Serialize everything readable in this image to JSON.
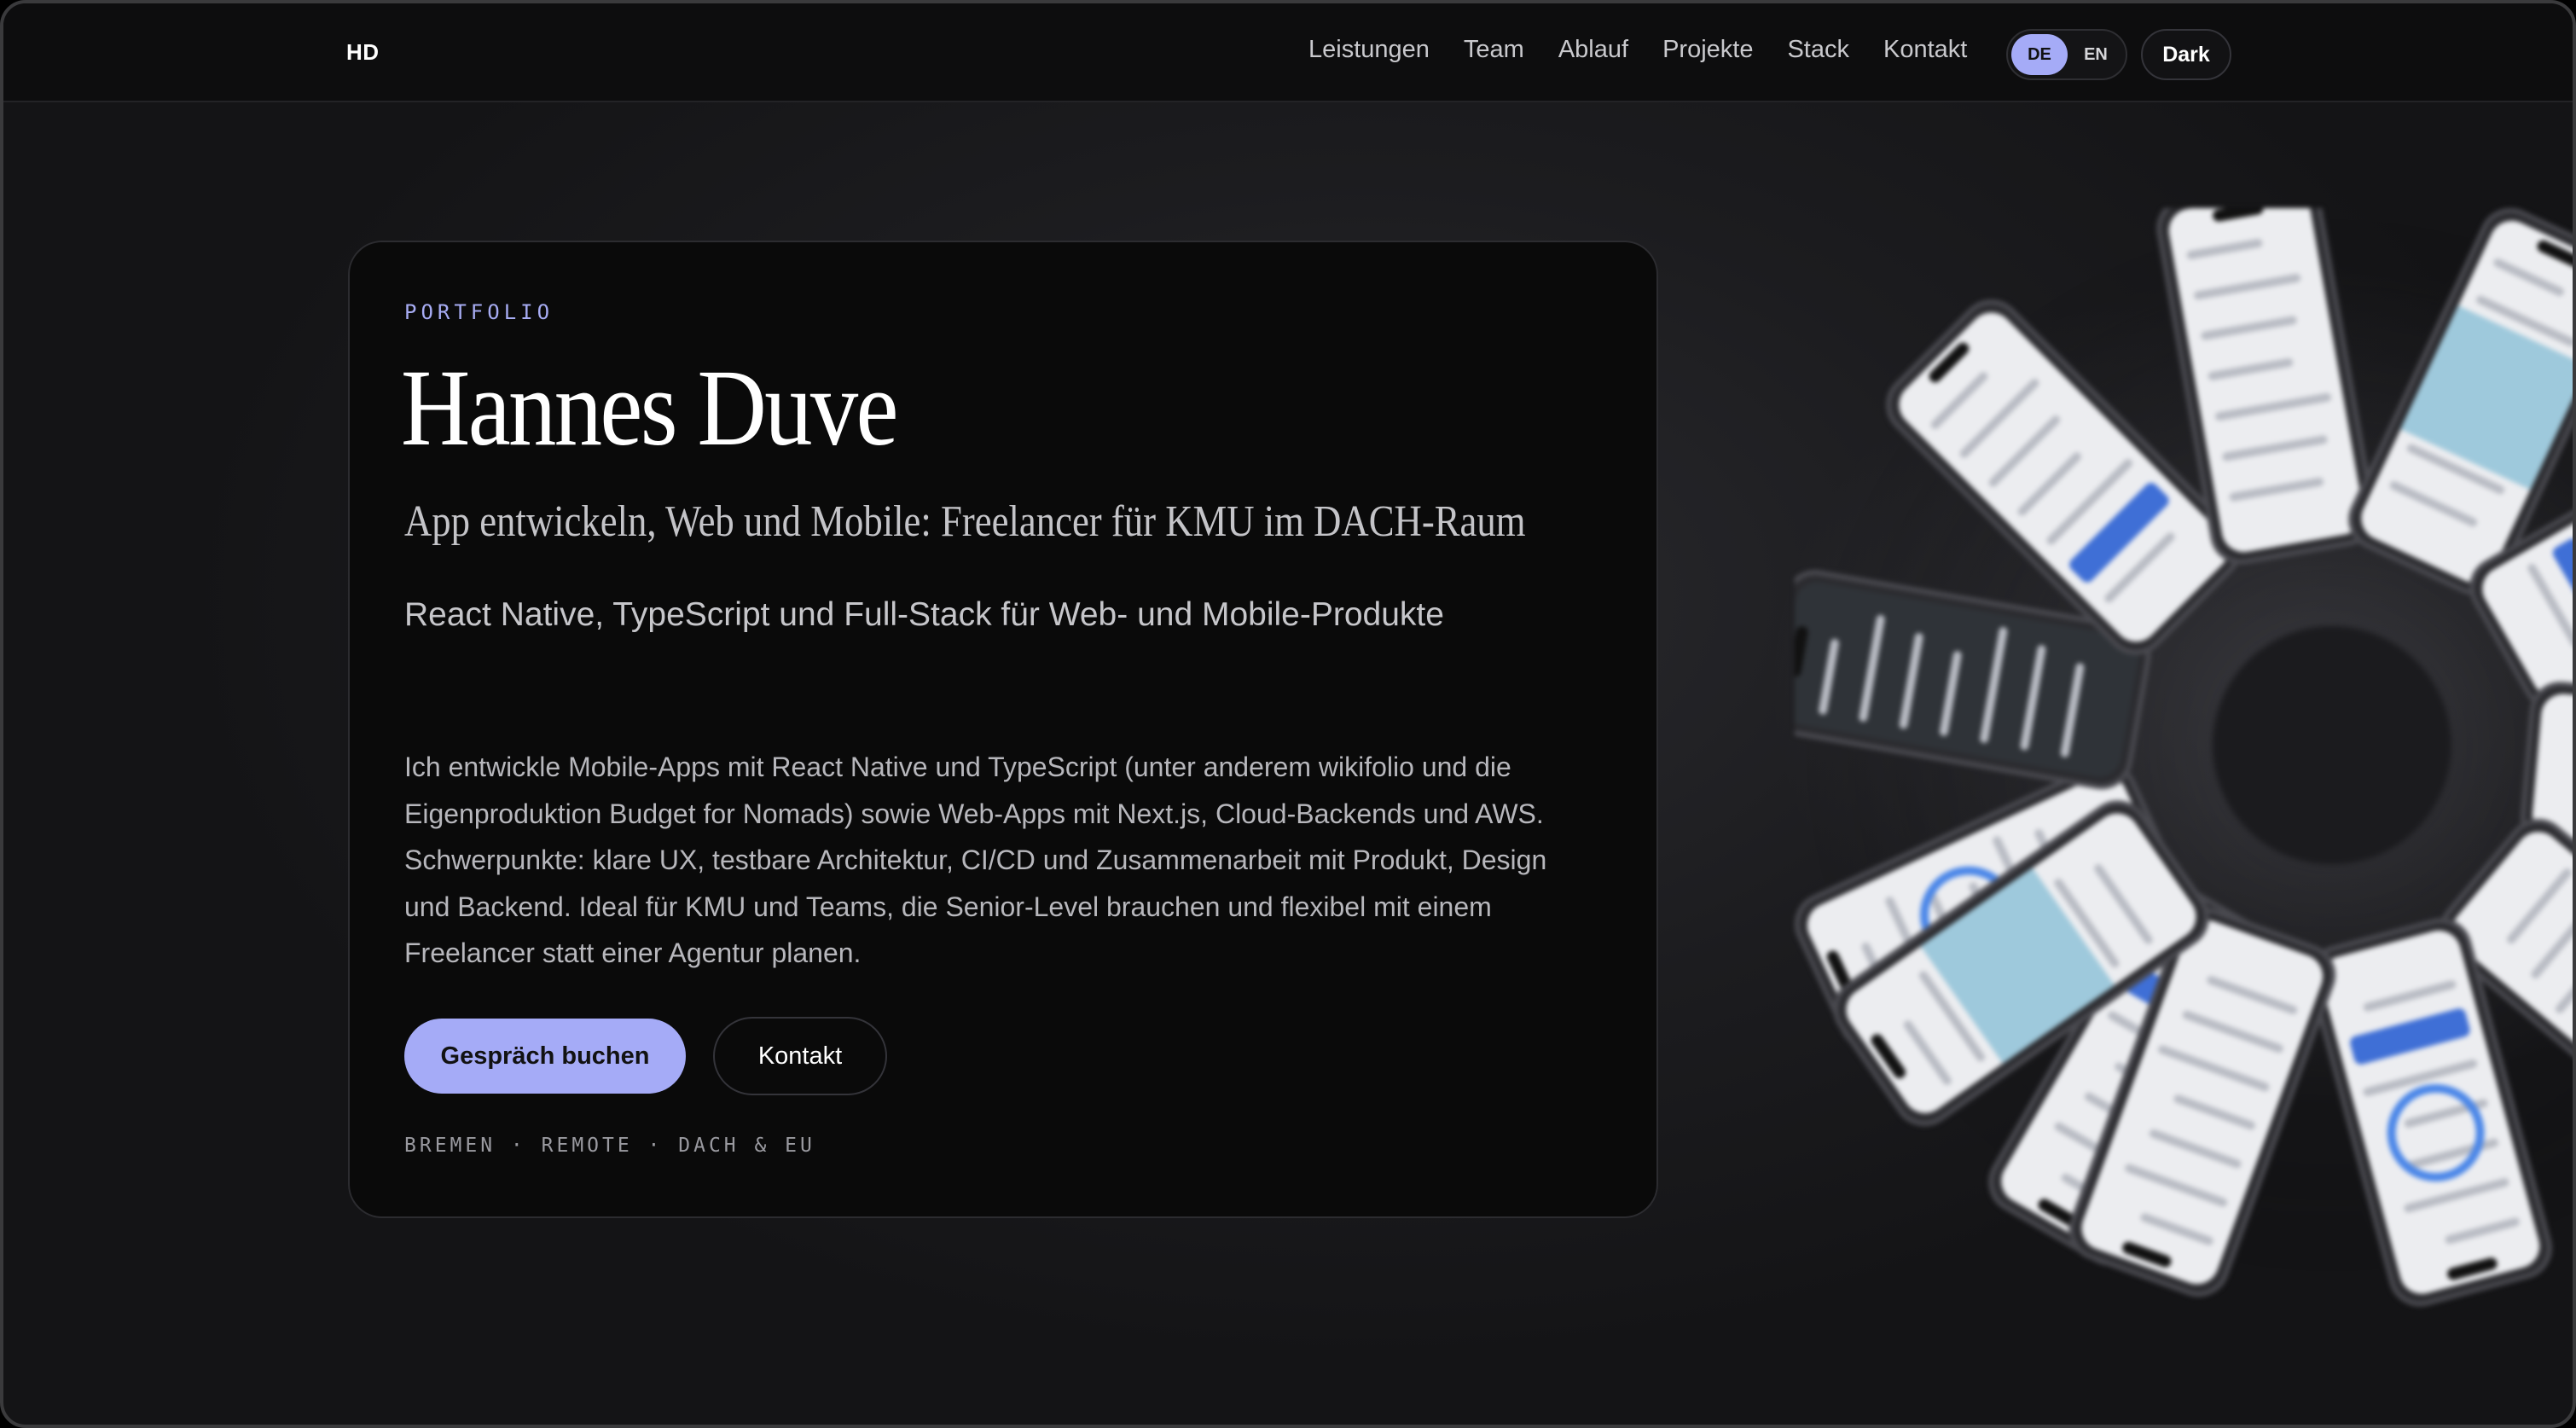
{
  "nav": {
    "logo": "HD",
    "links": [
      "Leistungen",
      "Team",
      "Ablauf",
      "Projekte",
      "Stack",
      "Kontakt"
    ],
    "lang": {
      "active": "DE",
      "inactive": "EN"
    },
    "theme_label": "Dark"
  },
  "hero": {
    "eyebrow": "PORTFOLIO",
    "name": "Hannes Duve",
    "tagline": "App entwickeln, Web und Mobile: Freelancer für KMU im DACH-Raum",
    "subhead": "React Native, TypeScript und Full-Stack für Web- und Mobile-Produkte",
    "description": "Ich entwickle Mobile-Apps mit React Native und TypeScript (unter anderem wikifolio und die Eigenproduktion Budget for Nomads) sowie Web-Apps mit Next.js, Cloud-Backends und AWS. Schwerpunkte: klare UX, testbare Architektur, CI/CD und Zusammenarbeit mit Produkt, Design und Backend. Ideal für KMU und Teams, die Senior-Level brauchen und flexibel mit einem Freelancer statt einer Agentur planen.",
    "cta_primary": "Gespräch buchen",
    "cta_secondary": "Kontakt",
    "location": "BREMEN · REMOTE · DACH & EU"
  },
  "colors": {
    "accent": "#a5abf7",
    "background": "#1c1c1f",
    "card": "#0a0a0a"
  },
  "visual": {
    "icon": "phone-wheel-illustration"
  }
}
